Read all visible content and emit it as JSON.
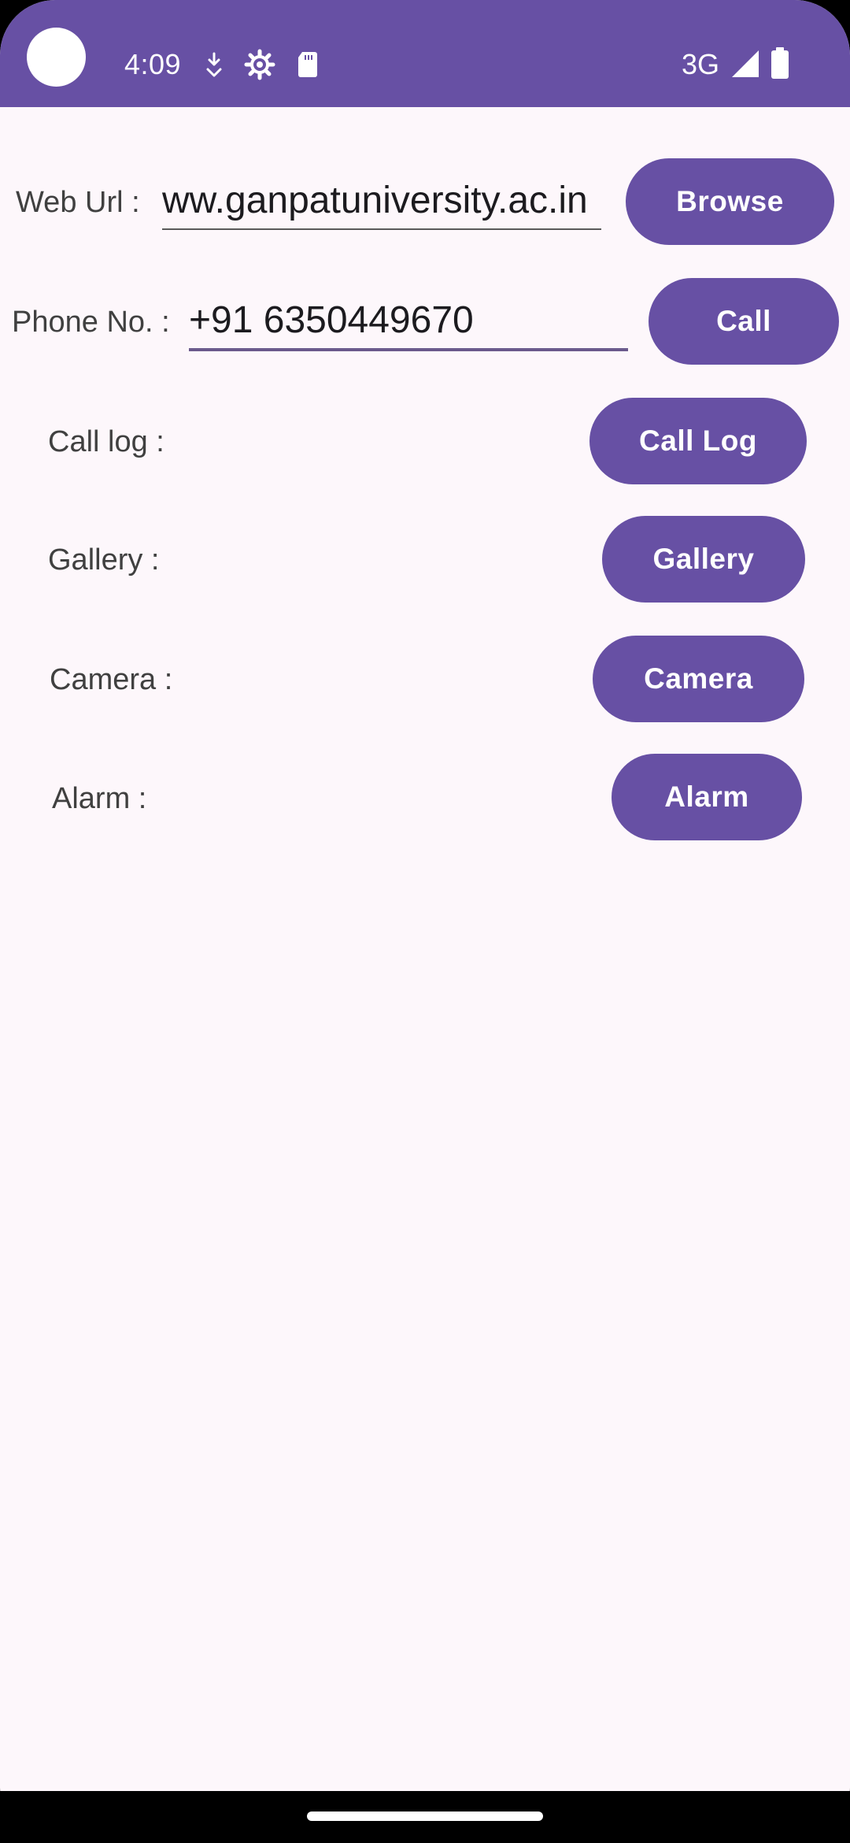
{
  "status_bar": {
    "time": "4:09",
    "network": "3G",
    "icons": [
      "download-icon",
      "settings-gear-icon",
      "sd-card-icon",
      "signal-icon",
      "battery-icon"
    ]
  },
  "form": {
    "web_url": {
      "label": "Web Url :",
      "value": "ww.ganpatuniversity.ac.in",
      "button": "Browse"
    },
    "phone": {
      "label": "Phone No. :",
      "value": "+91 6350449670",
      "button": "Call"
    },
    "call_log": {
      "label": "Call log :",
      "button": "Call Log"
    },
    "gallery": {
      "label": "Gallery :",
      "button": "Gallery"
    },
    "camera": {
      "label": "Camera :",
      "button": "Camera"
    },
    "alarm": {
      "label": "Alarm :",
      "button": "Alarm"
    }
  },
  "colors": {
    "primary": "#6750a4",
    "background": "#fdf7fb",
    "label": "#404040"
  }
}
